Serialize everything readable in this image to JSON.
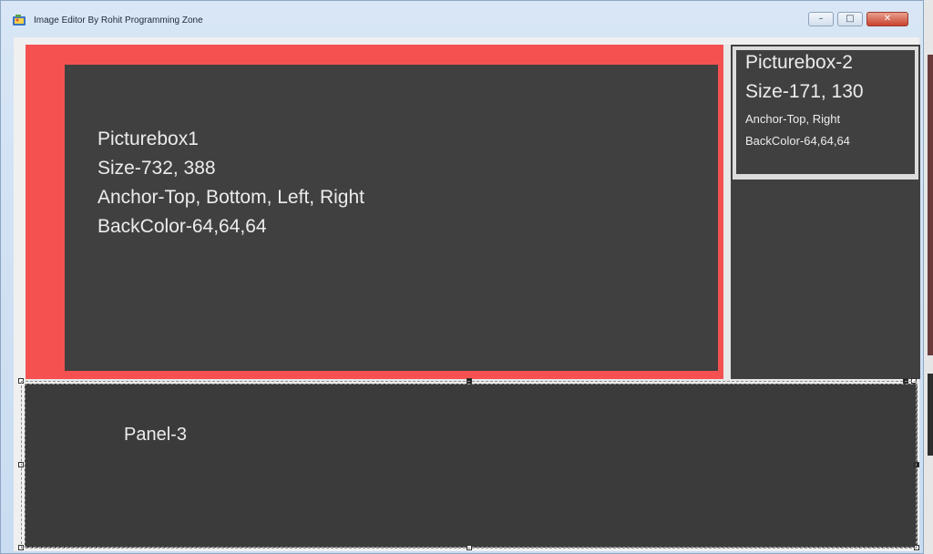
{
  "window": {
    "title": "Image Editor By Rohit Programming Zone",
    "buttons": {
      "minimize": "–",
      "maximize": "□",
      "close": "✕"
    }
  },
  "picturebox1": {
    "lines": [
      "Picturebox1",
      "Size-732, 388",
      "Anchor-Top, Bottom, Left, Right",
      "BackColor-64,64,64"
    ],
    "border_color": "#f55151",
    "back_color": "#404040"
  },
  "picturebox2": {
    "title": "Picturebox-2",
    "size": "Size-171, 130",
    "anchor": "Anchor-Top, Right",
    "backcolor": "BackColor-64,64,64",
    "back_color": "#404040"
  },
  "panel3": {
    "label": "Panel-3",
    "back_color": "#3b3b3b"
  },
  "icons": {
    "app": "app-icon",
    "minimize": "minimize-icon",
    "maximize": "maximize-icon",
    "close": "close-icon"
  }
}
